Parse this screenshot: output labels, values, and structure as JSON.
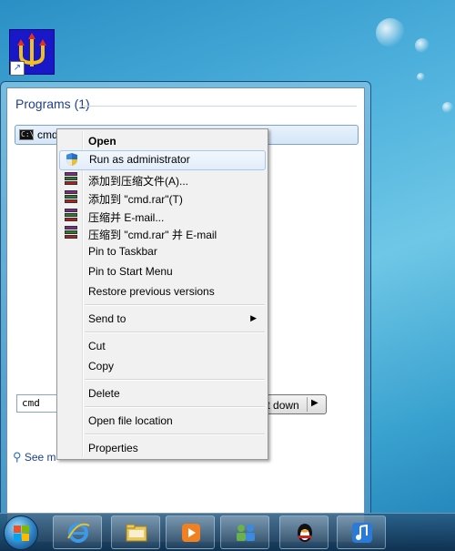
{
  "desktop": {
    "icon": {
      "name": "trident-app-icon",
      "label": ""
    }
  },
  "start_menu": {
    "programs_header": "Programs (1)",
    "program_items": [
      {
        "label": "cmd",
        "icon": "cmd-icon"
      }
    ],
    "see_more": "See m",
    "search": {
      "value": "cmd"
    },
    "shutdown_label": "Shut down",
    "shutdown_arrow": "▶",
    "clear_icon": "✕"
  },
  "context_menu": {
    "items": [
      {
        "label": "Open",
        "bold": true
      },
      {
        "label": "Run as administrator",
        "icon": "uac-shield-icon",
        "highlighted": true
      },
      {
        "label": "添加到压缩文件(A)...",
        "icon": "winrar-icon"
      },
      {
        "label": "添加到 \"cmd.rar\"(T)",
        "icon": "winrar-icon"
      },
      {
        "label": "压缩并 E-mail...",
        "icon": "winrar-icon"
      },
      {
        "label": "压缩到 \"cmd.rar\" 并 E-mail",
        "icon": "winrar-icon"
      },
      {
        "label": "Pin to Taskbar"
      },
      {
        "label": "Pin to Start Menu"
      },
      {
        "label": "Restore previous versions"
      },
      {
        "label": "Send to",
        "submenu": true
      },
      {
        "label": "Cut"
      },
      {
        "label": "Copy"
      },
      {
        "label": "Delete"
      },
      {
        "label": "Open file location"
      },
      {
        "label": "Properties"
      }
    ],
    "submenu_arrow": "▶"
  },
  "taskbar": {
    "start_icon": "windows-orb-icon",
    "pinned": [
      {
        "name": "internet-explorer-icon"
      },
      {
        "name": "file-explorer-icon"
      },
      {
        "name": "media-player-icon"
      },
      {
        "name": "network-meeting-icon"
      },
      {
        "name": "qq-penguin-icon"
      },
      {
        "name": "music-note-icon"
      }
    ]
  },
  "colors": {
    "programs_header": "#1e3e8c",
    "menu_highlight_border": "#a8c8ec",
    "taskbar": "#1f4a72"
  }
}
